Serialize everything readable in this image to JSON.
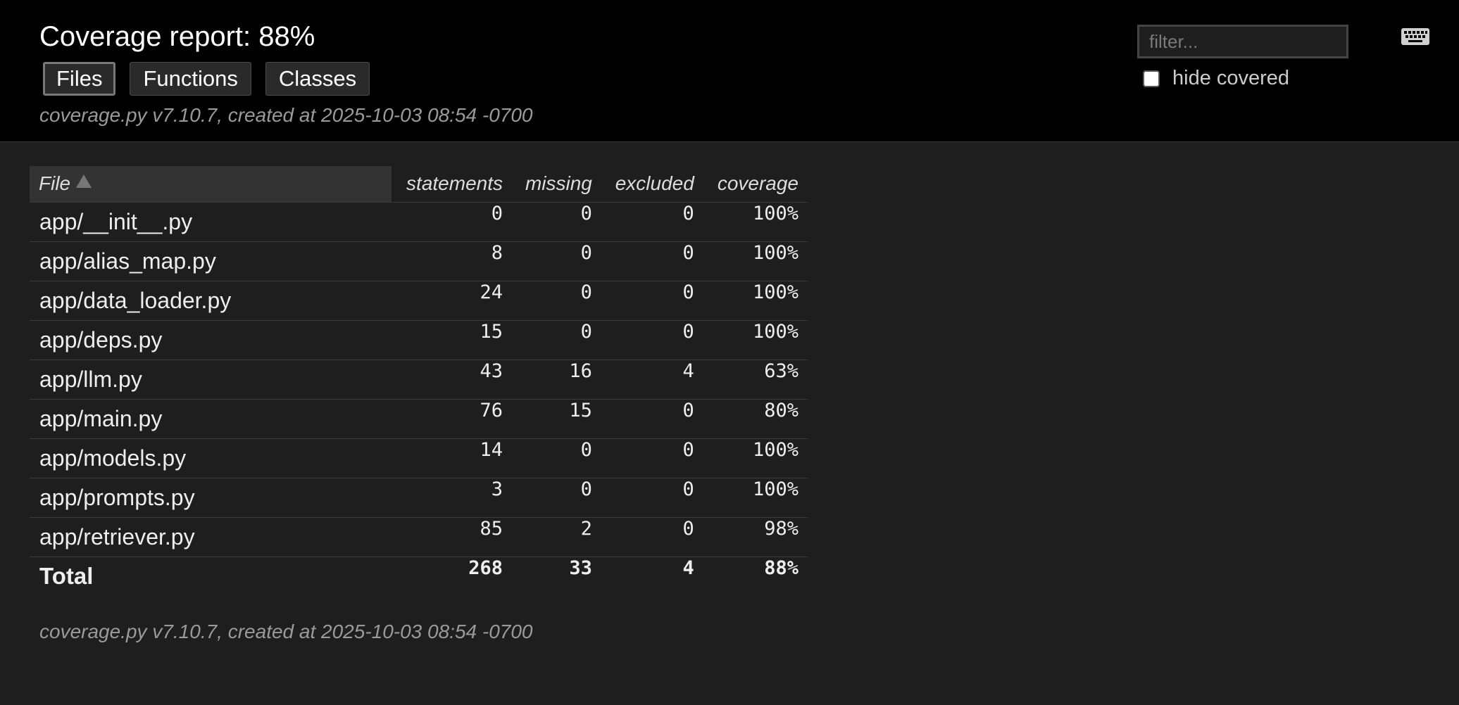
{
  "header": {
    "title": "Coverage report: 88%",
    "tabs": [
      {
        "label": "Files",
        "current": true
      },
      {
        "label": "Functions"
      },
      {
        "label": "Classes"
      }
    ],
    "created": "coverage.py v7.10.7, created at 2025-10-03 08:54 -0700",
    "filter_placeholder": "filter...",
    "hide_covered_label": "hide covered",
    "keyboard_icon": "keyboard-icon"
  },
  "table": {
    "columns": [
      "File",
      "statements",
      "missing",
      "excluded",
      "coverage"
    ],
    "sorted_column": "File",
    "sort_direction": "ascending",
    "rows": [
      {
        "file": "app/__init__.py",
        "statements": "0",
        "missing": "0",
        "excluded": "0",
        "coverage": "100%"
      },
      {
        "file": "app/alias_map.py",
        "statements": "8",
        "missing": "0",
        "excluded": "0",
        "coverage": "100%"
      },
      {
        "file": "app/data_loader.py",
        "statements": "24",
        "missing": "0",
        "excluded": "0",
        "coverage": "100%"
      },
      {
        "file": "app/deps.py",
        "statements": "15",
        "missing": "0",
        "excluded": "0",
        "coverage": "100%"
      },
      {
        "file": "app/llm.py",
        "statements": "43",
        "missing": "16",
        "excluded": "4",
        "coverage": "63%"
      },
      {
        "file": "app/main.py",
        "statements": "76",
        "missing": "15",
        "excluded": "0",
        "coverage": "80%"
      },
      {
        "file": "app/models.py",
        "statements": "14",
        "missing": "0",
        "excluded": "0",
        "coverage": "100%"
      },
      {
        "file": "app/prompts.py",
        "statements": "3",
        "missing": "0",
        "excluded": "0",
        "coverage": "100%"
      },
      {
        "file": "app/retriever.py",
        "statements": "85",
        "missing": "2",
        "excluded": "0",
        "coverage": "98%"
      }
    ],
    "total": {
      "file": "Total",
      "statements": "268",
      "missing": "33",
      "excluded": "4",
      "coverage": "88%"
    }
  },
  "footer": {
    "created": "coverage.py v7.10.7, created at 2025-10-03 08:54 -0700"
  }
}
